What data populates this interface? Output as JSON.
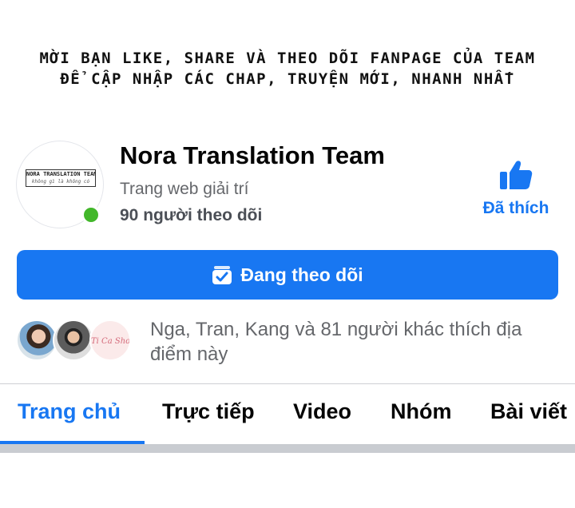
{
  "banner": {
    "line1": "MỜI BẠN LIKE, SHARE VÀ THEO DÕI FANPAGE CỦA TEAM",
    "line2": "ĐỂ CẬP NHẬP CÁC CHAP, TRUYỆN MỚI, NHANH NHẤT"
  },
  "page": {
    "avatar_logo_title": "NORA TRANSLATION TEAM",
    "avatar_logo_sub": "không gì là không có",
    "name": "Nora Translation Team",
    "category": "Trang web giải trí",
    "followers": "90 người theo dõi",
    "online_color": "#42b72a"
  },
  "like": {
    "icon": "thumbs-up-icon",
    "label": "Đã thích"
  },
  "follow_button": {
    "icon": "following-check-icon",
    "label": "Đang theo dõi",
    "color": "#1877f2"
  },
  "friends": {
    "avatar3_text": "Ti Ca Shop",
    "text": "Nga, Tran, Kang và 81 người khác thích địa điểm này"
  },
  "tabs": [
    {
      "label": "Trang chủ",
      "active": true
    },
    {
      "label": "Trực tiếp",
      "active": false
    },
    {
      "label": "Video",
      "active": false
    },
    {
      "label": "Nhóm",
      "active": false
    },
    {
      "label": "Bài viết",
      "active": false
    }
  ]
}
